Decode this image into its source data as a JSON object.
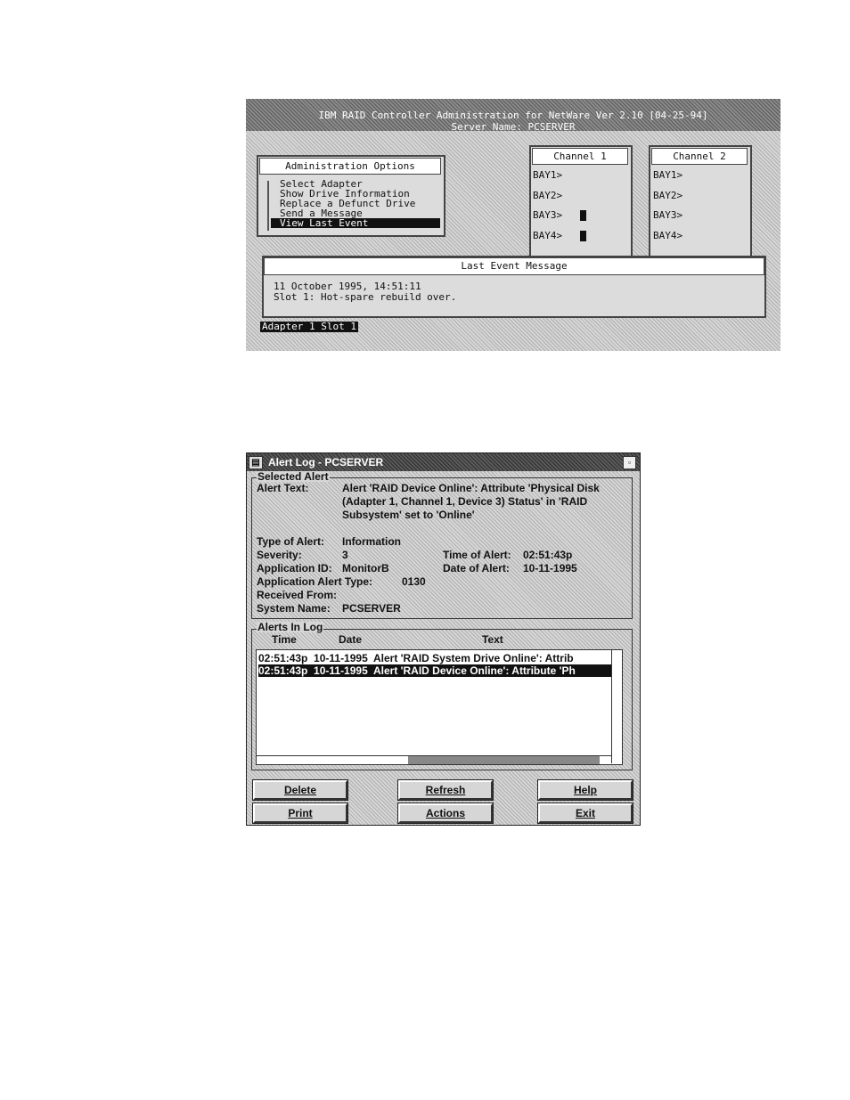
{
  "console": {
    "header_line1": "IBM RAID Controller Administration for NetWare  Ver 2.10 [04-25-94]",
    "header_line2": "Server Name: PCSERVER",
    "admin_title": "Administration Options",
    "admin_items": [
      "Select Adapter",
      "Show Drive Information",
      "Replace a Defunct Drive",
      "Send a Message",
      "View Last Event"
    ],
    "channels": [
      {
        "title": "Channel 1",
        "bays": [
          "BAY1>",
          "BAY2>",
          "BAY3>",
          "BAY4>"
        ]
      },
      {
        "title": "Channel 2",
        "bays": [
          "BAY1>",
          "BAY2>",
          "BAY3>",
          "BAY4>"
        ]
      }
    ],
    "event_title": "Last Event Message",
    "event_line1": "11 October 1995, 14:51:11",
    "event_line2": "Slot 1: Hot-spare rebuild over.",
    "status": "Adapter 1 Slot 1"
  },
  "alert_window": {
    "title": "Alert Log - PCSERVER",
    "selected_group": "Selected Alert",
    "alert_text_label": "Alert Text:",
    "alert_text_1": "Alert 'RAID Device Online': Attribute 'Physical Disk",
    "alert_text_2": "(Adapter 1, Channel 1, Device 3) Status' in 'RAID",
    "alert_text_3": "Subsystem' set to 'Online'",
    "type_label": "Type of Alert:",
    "type_value": "Information",
    "severity_label": "Severity:",
    "severity_value": "3",
    "time_label": "Time of Alert:",
    "time_value": "02:51:43p",
    "appid_label": "Application ID:",
    "appid_value": "MonitorB",
    "date_label": "Date of Alert:",
    "date_value": "10-11-1995",
    "apptype_label": "Application Alert Type:",
    "apptype_value": "0130",
    "received_label": "Received From:",
    "sysname_label": "System Name:",
    "sysname_value": "PCSERVER",
    "log_group": "Alerts In Log",
    "col_time": "Time",
    "col_date": "Date",
    "col_text": "Text",
    "rows": [
      "02:51:43p  10-11-1995  Alert 'RAID System Drive Online': Attrib",
      "02:51:43p  10-11-1995  Alert 'RAID Device Online': Attribute 'Ph"
    ],
    "buttons": {
      "delete": "Delete",
      "refresh": "Refresh",
      "help": "Help",
      "print": "Print",
      "actions": "Actions",
      "exit": "Exit"
    }
  }
}
